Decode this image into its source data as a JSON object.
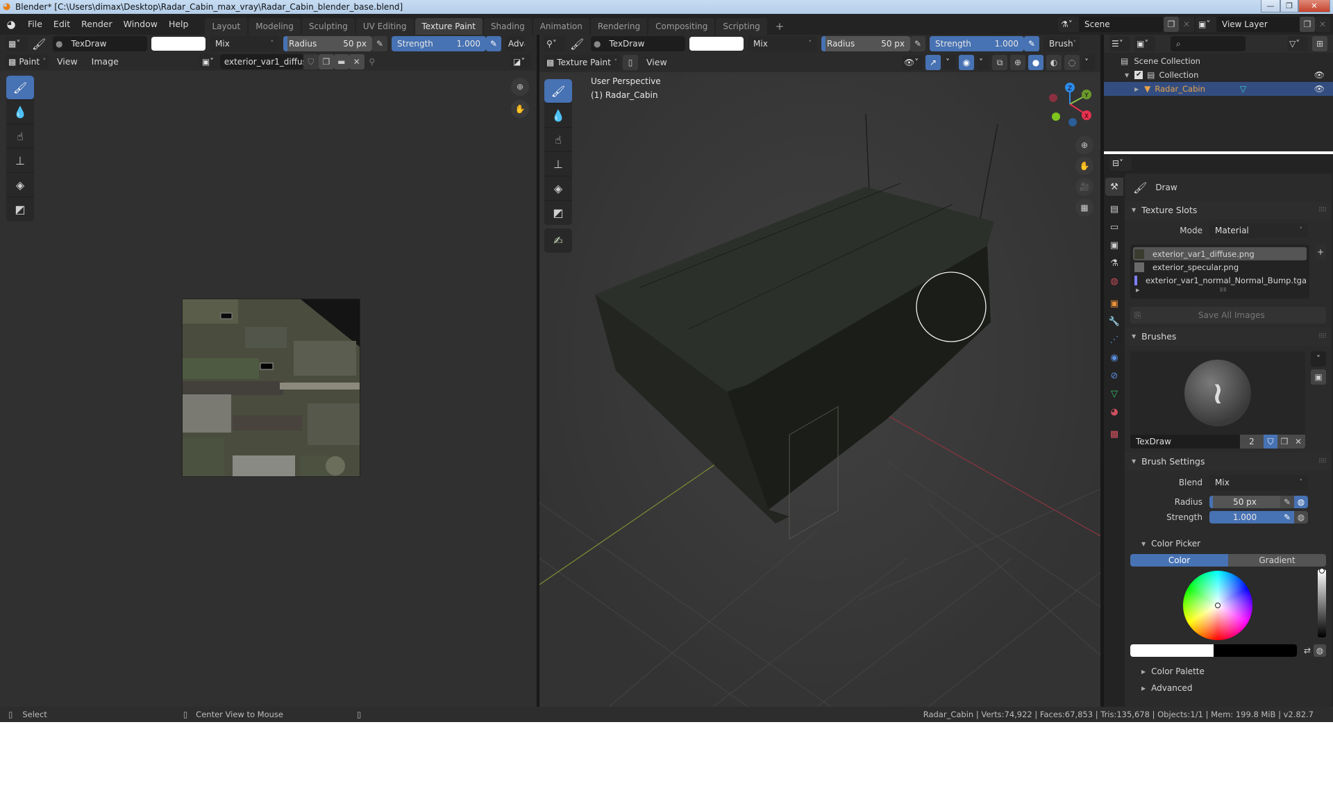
{
  "window": {
    "title": "Blender* [C:\\Users\\dimax\\Desktop\\Radar_Cabin_max_vray\\Radar_Cabin_blender_base.blend]",
    "controls": {
      "minimize": "—",
      "restore": "❐",
      "close": "✕"
    }
  },
  "menu": {
    "items": [
      "File",
      "Edit",
      "Render",
      "Window",
      "Help"
    ],
    "workspaces": [
      "Layout",
      "Modeling",
      "Sculpting",
      "UV Editing",
      "Texture Paint",
      "Shading",
      "Animation",
      "Rendering",
      "Compositing",
      "Scripting"
    ],
    "active_workspace": "Texture Paint",
    "add_workspace": "+",
    "scene": "Scene",
    "view_layer": "View Layer"
  },
  "image_editor": {
    "tool_header": {
      "brush_name": "TexDraw",
      "color_hex": "#ffffff",
      "blend": "Mix",
      "radius_label": "Radius",
      "radius_value": "50 px",
      "radius_fraction": 0.05,
      "strength_label": "Strength",
      "strength_value": "1.000",
      "strength_fraction": 1.0,
      "advanced_label": "Adva"
    },
    "header": {
      "mode": "Paint",
      "menus": [
        "View",
        "Image"
      ],
      "image_name": "exterior_var1_diffus.."
    },
    "tools": [
      "brush-draw",
      "brush-soften",
      "brush-smear",
      "brush-clone",
      "brush-fill",
      "brush-mask"
    ]
  },
  "viewport": {
    "tool_header": {
      "brush_name": "TexDraw",
      "color_hex": "#ffffff",
      "blend": "Mix",
      "radius_label": "Radius",
      "radius_value": "50 px",
      "strength_label": "Strength",
      "strength_value": "1.000",
      "brush_menu": "Brush"
    },
    "header": {
      "mode": "Texture Paint",
      "menus": [
        "View"
      ]
    },
    "overlay_text": {
      "perspective": "User Perspective",
      "object": "(1) Radar_Cabin"
    },
    "gizmo": {
      "x": "X",
      "y": "Y",
      "z": "Z"
    },
    "tools": [
      "brush-draw",
      "brush-soften",
      "brush-smear",
      "brush-clone",
      "brush-fill",
      "brush-mask",
      "annotate"
    ]
  },
  "outliner": {
    "search_placeholder": "",
    "items": [
      {
        "label": "Scene Collection",
        "level": 0
      },
      {
        "label": "Collection",
        "level": 1,
        "checked": true
      },
      {
        "label": "Radar_Cabin",
        "level": 2,
        "selected": true
      }
    ]
  },
  "properties": {
    "active_tool": "Draw",
    "texture_slots": {
      "title": "Texture Slots",
      "mode_label": "Mode",
      "mode_value": "Material",
      "slots": [
        "exterior_var1_diffuse.png",
        "exterior_specular.png",
        "exterior_var1_normal_Normal_Bump.tga"
      ],
      "selected_index": 0,
      "save_all": "Save All Images"
    },
    "brushes": {
      "title": "Brushes",
      "name": "TexDraw",
      "users": "2"
    },
    "brush_settings": {
      "title": "Brush Settings",
      "blend_label": "Blend",
      "blend_value": "Mix",
      "radius_label": "Radius",
      "radius_value": "50 px",
      "radius_fraction": 0.05,
      "strength_label": "Strength",
      "strength_value": "1.000",
      "strength_fraction": 1.0
    },
    "color_picker": {
      "title": "Color Picker",
      "tabs": [
        "Color",
        "Gradient"
      ],
      "active_tab": "Color",
      "primary_color": "#ffffff",
      "secondary_color": "#000000",
      "value": 1.0
    },
    "collapsed_panels": [
      "Color Palette",
      "Advanced"
    ]
  },
  "statusbar": {
    "left": [
      {
        "icon": "mouse-left-icon",
        "label": "Select"
      },
      {
        "icon": "mouse-middle-icon",
        "label": "Center View to Mouse"
      },
      {
        "icon": "mouse-right-icon",
        "label": ""
      }
    ],
    "stats": "Radar_Cabin | Verts:74,922 | Faces:67,853 | Tris:135,678 | Objects:1/1 | Mem: 199.8 MiB | v2.82.7"
  },
  "colors": {
    "accent": "#4772b3",
    "selected_object": "#e8a24a",
    "axis_x": "#e8314f",
    "axis_y": "#8bc34a",
    "axis_z": "#2d8ceb"
  }
}
